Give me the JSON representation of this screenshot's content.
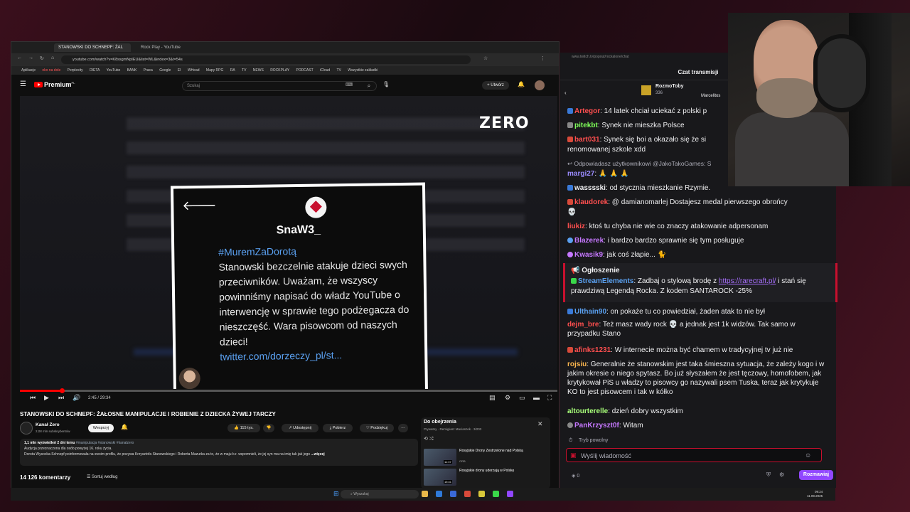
{
  "browser": {
    "tabs": [
      {
        "label": "STANOWSKI DO SCHNEPF: ŻAL"
      },
      {
        "label": "Rock Play - YouTube"
      }
    ],
    "url": "youtube.com/watch?v=K8ssgmNpIEU&list=WL&index=3&t=54s",
    "bookmarks": [
      "Aplikacje",
      "oko na dole",
      "Perplexity",
      "DIETA",
      "YouTube",
      "BANK",
      "Praca",
      "Google",
      "EI",
      "WHead",
      "Mapy RPG",
      "RA",
      "TV",
      "NEWS",
      "ROCKPLAY",
      "PODCAST",
      "iCloud",
      "TV",
      "Wszystkie zakładki"
    ]
  },
  "youtube": {
    "logo": "Premium",
    "logo_sup": "PL",
    "search_placeholder": "Szukaj",
    "create_label": "Utwórz",
    "video": {
      "watermark": "ZERO",
      "card_name": "SnaW3_",
      "card_hashtag": "#MuremZaDorotą",
      "card_text": "Stanowski bezczelnie atakuje dzieci swych przeciwników. Uważam, że wszyscy powinniśmy napisać do władz YouTube o interwencję w sprawie tego podżegacza do nieszczęść. Wara pisowcom od naszych dzieci!",
      "card_link": "twitter.com/dorzeczy_pl/st...",
      "time": "2:45 / 29:34"
    },
    "title": "STANOWSKI DO SCHNEPF: ŻAŁOSNE MANIPULACJE I ROBIENIE Z DZIECKA ŻYWEJ TARCZY",
    "channel": {
      "name": "Kanał Zero",
      "subs": "2,08 mln subskrybentów",
      "support": "Wesprzyj"
    },
    "actions": {
      "likes": "115 tys.",
      "share": "Udostępnij",
      "download": "Pobierz",
      "thanks": "Podziękuj"
    },
    "description": {
      "stats": "1,1 mln wyświetleń  2 dni temu",
      "tags": "#manipulacja #stanowski #kanalzero",
      "line1": "Audycja przeznaczona dla osób powyżej 16. roku życia.",
      "line2": "Dorota Wysocka-Schnepf poinformowała na swoim profilu, że pozywa Krzysztofa Stanowskiego i Roberta Mazurka za to, że w maju b.r. wspomnieli, że jej syn ma na imię tak jak jego",
      "more": "...więcej"
    },
    "comments": "14 126 komentarzy",
    "sort": "Sortuj według",
    "queue": {
      "title": "Do obejrzenia",
      "sub": "Prywatny · Remigiusz Maciaszek · 3/203",
      "items": [
        {
          "title": "Rosyjskie Drony Zestrzelone nad Polską",
          "meta": "ORB",
          "dur": "11:37"
        },
        {
          "title": "Rosyjskie drony uderzają w Polskę",
          "meta": "",
          "dur": "15:41"
        }
      ]
    }
  },
  "taskbar": {
    "search": "Wyszukaj",
    "time": "09:24",
    "date": "11.09.2025"
  },
  "chat": {
    "url": "www.twitch.tv/popout/rockalone/chat",
    "title": "Czat transmisji",
    "gift_user": "RozmoToby",
    "gift_count": "336",
    "gift_user2": "Marcelitos",
    "messages": [
      {
        "user": "Artegor",
        "color": "#ff4f4f",
        "text": ": 14 latek chciał uciekać z polski p"
      },
      {
        "user": "pitekbt",
        "color": "#7fff5a",
        "text": ": Synek nie mieszka Polsce"
      },
      {
        "user": "bart031",
        "color": "#ff4f4f",
        "text": ": Synek się boi a okazało się że si"
      },
      {
        "user": "",
        "color": "#efeff1",
        "text": "renomowanej szkole xdd"
      },
      {
        "user": "",
        "color": "#adadb8",
        "text": "Odpowiadasz użytkownikowi @JakoTakoGames: S"
      },
      {
        "user": "margi27",
        "color": "#9b8cff",
        "text": ": 🙏 🙏 🙏"
      },
      {
        "user": "wasssski",
        "color": "#efeff1",
        "text": ": od stycznia mieszkanie Rzymie."
      },
      {
        "user": "klaudorek",
        "color": "#ff4f4f",
        "text": ": @ damianomarlej Dostajesz medal pierwszego obrońcy"
      },
      {
        "user": "",
        "color": "#efeff1",
        "text": "💀"
      },
      {
        "user": "liukiz",
        "color": "#ff4f4f",
        "text": ": ktoś tu chyba nie wie co znaczy atakowanie adpersonam"
      },
      {
        "user": "Blazerek",
        "color": "#c678ff",
        "text": ": i bardzo bardzo sprawnie się tym posługuje"
      },
      {
        "user": "Kwasik9",
        "color": "#c678ff",
        "text": ": jak coś złapie... 🐈"
      }
    ],
    "announce_label": "Ogłoszenie",
    "announce_user": "StreamElements",
    "announce_text_1": ": Zadbaj o stylową brodę z ",
    "announce_link": "https://rarecraft.pl/",
    "announce_text_2": " i stań się prawdziwą Legendą Rocka. Z kodem SANTAROCK -25%",
    "messages2": [
      {
        "user": "Ulthain90",
        "color": "#5aa0f0",
        "text": ": on pokaże tu co powiedział, żaden atak to nie był"
      },
      {
        "user": "dejm_bre",
        "color": "#ff4f4f",
        "text": ": Też masz wady rock 💀 a jednak jest 1k widzów. Tak samo w przypadku Stano"
      },
      {
        "user": "afinks1231",
        "color": "#ff4f4f",
        "text": ": W internecie można być chamem w tradycyjnej tv już nie"
      },
      {
        "user": "rojsiu",
        "color": "#ffb84f",
        "text": ": Generalnie że stanowskim jest taka śmieszna sytuacja, że zależy kogo i w jakim okresie o niego spytasz. Bo już słyszałem że jest tęczowy, homofobem, jak krytykował PiS u władzy to pisowcy go nazywali psem Tuska, teraz jak krytykuje KO to jest pisowcem i tak w kółko"
      },
      {
        "user": "altourterelle",
        "color": "#a8ff7a",
        "text": ": dzień dobry wszystkim"
      },
      {
        "user": "PanKrzyszt0f",
        "color": "#c678ff",
        "text": ": Witam"
      }
    ],
    "slow_mode": "Tryb powolny",
    "input_placeholder": "Wyślij wiadomość",
    "points": "0",
    "send_button": "Rozmawiaj"
  },
  "colors": {
    "yt_red": "#ff0000",
    "twitch_purple": "#9147ff",
    "link_blue": "#5aa0f0",
    "accent_red": "#c8102e"
  }
}
